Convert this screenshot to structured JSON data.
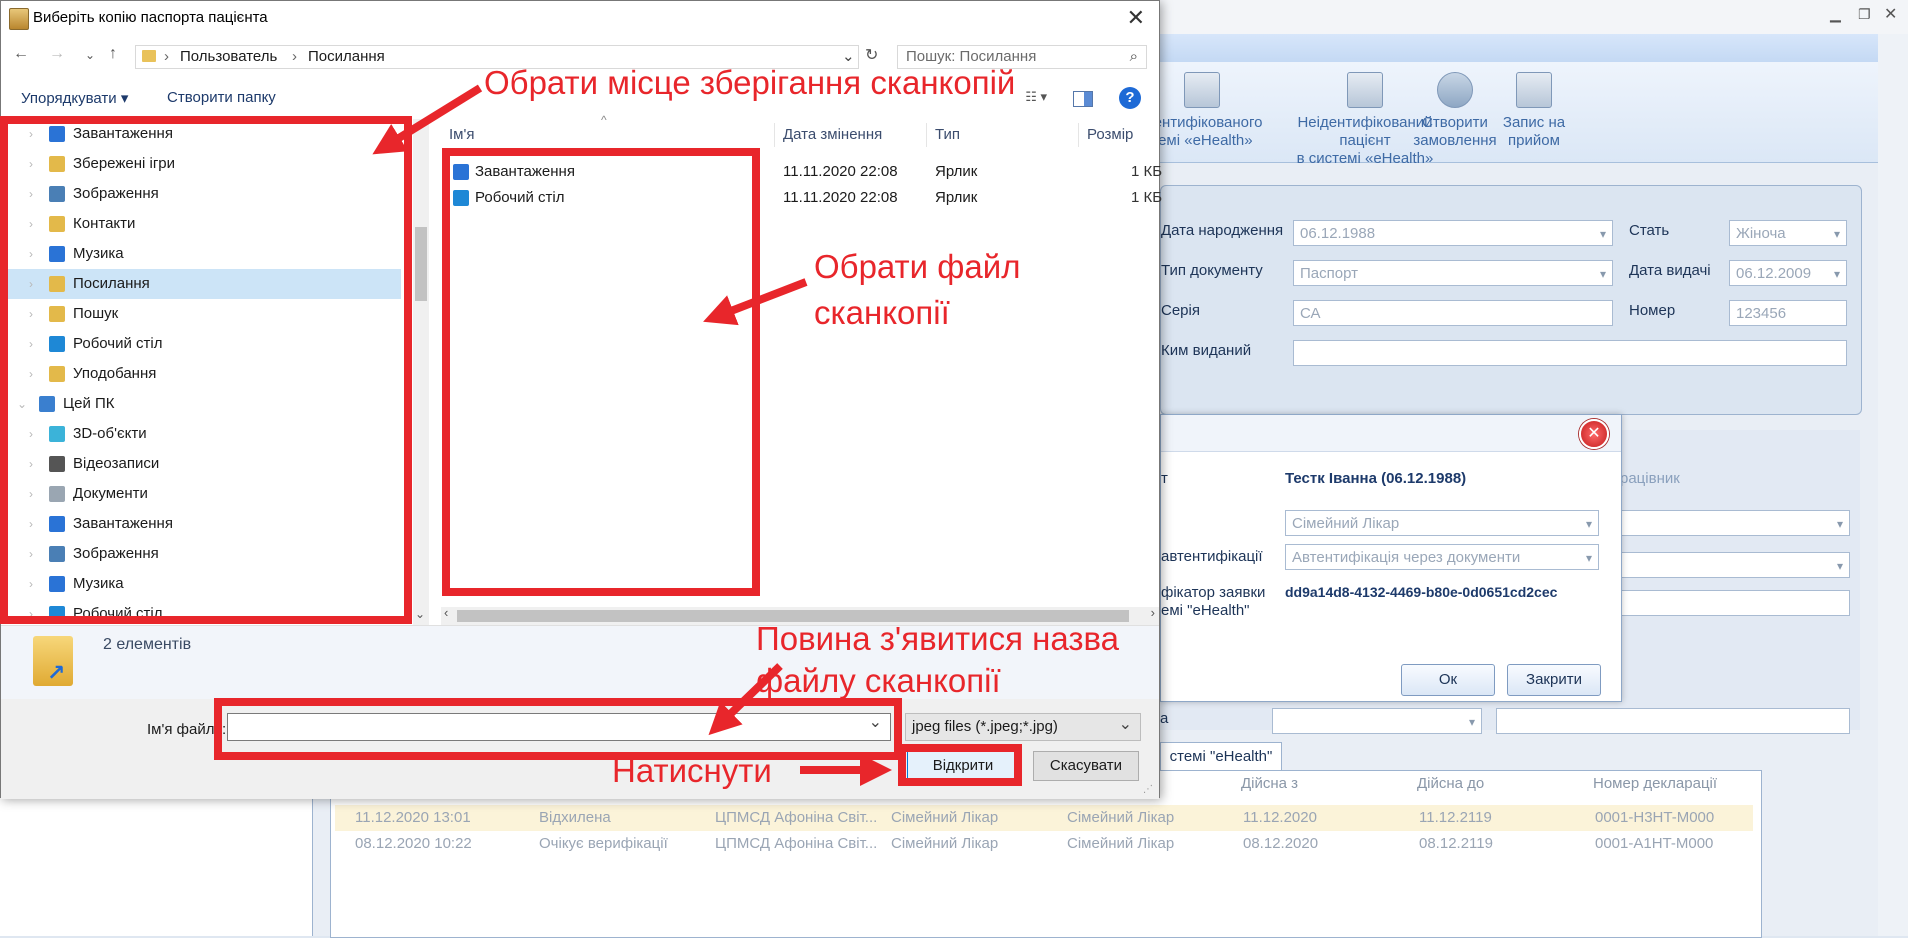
{
  "background_app": {
    "ribbon_buttons": [
      {
        "line1": "ідентифікованого",
        "line2": "темі «eHealth»"
      },
      {
        "line1": "Неідентифікований пацієнт",
        "line2": "в системі «eHealth»"
      },
      {
        "line1": "Створити",
        "line2": "замовлення"
      },
      {
        "line1": "Запис на",
        "line2": "прийом"
      }
    ],
    "form": {
      "birth_date_label": "Дата народження",
      "birth_date_value": "06.12.1988",
      "sex_label": "Стать",
      "sex_value": "Жіноча",
      "doc_type_label": "Тип документу",
      "doc_type_value": "Паспорт",
      "issue_date_label": "Дата видачі",
      "issue_date_value": "06.12.2009",
      "series_label": "Серія",
      "series_value": "СА",
      "number_label": "Номер",
      "number_value": "123456",
      "issued_by_label": "Ким виданий",
      "issued_by_value": ""
    },
    "right_partial_label": "рацівник",
    "modal": {
      "field1_label": "т",
      "patient": "Тестк Іванна  (06.12.1988)",
      "role_value": "Сімейний Лікар",
      "auth_label": "автентифікації",
      "auth_value": "Автентифікація через документи",
      "req_label_1": "фікатор заявки",
      "req_label_2": "емі \"eHealth\"",
      "req_id": "dd9a14d8-4132-4469-b80e-0d0651cd2cec",
      "ok_label": "Ок",
      "close_label": "Закрити"
    },
    "lower_label": "а",
    "tab_label": "стемі \"eHealth\"",
    "grid": {
      "headers": [
        "Дійсна з",
        "Дійсна до",
        "Номер декларації"
      ],
      "rows": [
        {
          "date": "11.12.2020 13:01",
          "status": "Відхилена",
          "org": "ЦПМСД Афоніна Світ...",
          "role1": "Сімейний Лікар",
          "role2": "Сімейний Лікар",
          "from": "11.12.2020",
          "to": "11.12.2119",
          "number": "0001-H3HT-M000"
        },
        {
          "date": "08.12.2020 10:22",
          "status": "Очікує верифікації",
          "org": "ЦПМСД Афоніна Світ...",
          "role1": "Сімейний Лікар",
          "role2": "Сімейний Лікар",
          "from": "08.12.2020",
          "to": "08.12.2119",
          "number": "0001-A1HT-M000"
        }
      ]
    }
  },
  "dialog": {
    "title": "Виберіть копію паспорта пацієнта",
    "breadcrumb": [
      "Пользователь",
      "Посилання"
    ],
    "search_placeholder": "Пошук: Посилання",
    "toolbar": {
      "organize": "Упорядкувати ▾",
      "new_folder": "Створити папку"
    },
    "tree": [
      {
        "label": "Завантаження",
        "indent": 1,
        "icon": "download-icon",
        "color": "#2a73d6"
      },
      {
        "label": "Збережені ігри",
        "indent": 1,
        "icon": "games-icon",
        "color": "#e3b94a"
      },
      {
        "label": "Зображення",
        "indent": 1,
        "icon": "pictures-icon",
        "color": "#4a7fb5"
      },
      {
        "label": "Контакти",
        "indent": 1,
        "icon": "contacts-icon",
        "color": "#e3b94a"
      },
      {
        "label": "Музика",
        "indent": 1,
        "icon": "music-icon",
        "color": "#2a73d6"
      },
      {
        "label": "Посилання",
        "indent": 1,
        "icon": "links-icon",
        "color": "#e3b94a",
        "selected": true
      },
      {
        "label": "Пошук",
        "indent": 1,
        "icon": "search-folder-icon",
        "color": "#e3b94a"
      },
      {
        "label": "Робочий стіл",
        "indent": 1,
        "icon": "desktop-icon",
        "color": "#1e88d6"
      },
      {
        "label": "Уподобання",
        "indent": 1,
        "icon": "favorites-icon",
        "color": "#e3b94a"
      },
      {
        "label": "Цей ПК",
        "indent": 0,
        "icon": "pc-icon",
        "color": "#3a7fcf"
      },
      {
        "label": "3D-об'єкти",
        "indent": 1,
        "icon": "3d-objects-icon",
        "color": "#3bb3d9"
      },
      {
        "label": "Відеозаписи",
        "indent": 1,
        "icon": "videos-icon",
        "color": "#555"
      },
      {
        "label": "Документи",
        "indent": 1,
        "icon": "documents-icon",
        "color": "#9aa6b2"
      },
      {
        "label": "Завантаження",
        "indent": 1,
        "icon": "download-icon",
        "color": "#2a73d6"
      },
      {
        "label": "Зображення",
        "indent": 1,
        "icon": "pictures-icon",
        "color": "#4a7fb5"
      },
      {
        "label": "Музика",
        "indent": 1,
        "icon": "music-icon",
        "color": "#2a73d6"
      },
      {
        "label": "Робочий стіл",
        "indent": 1,
        "icon": "desktop-icon",
        "color": "#1e88d6"
      }
    ],
    "columns": [
      "Ім'я",
      "Дата змінення",
      "Тип",
      "Розмір"
    ],
    "files": [
      {
        "name": "Завантаження",
        "date": "11.11.2020 22:08",
        "type": "Ярлик",
        "size": "1 КБ",
        "icon": "download-shortcut-icon",
        "color": "#2a73d6"
      },
      {
        "name": "Робочий стіл",
        "date": "11.11.2020 22:08",
        "type": "Ярлик",
        "size": "1 КБ",
        "icon": "desktop-shortcut-icon",
        "color": "#1e88d6"
      }
    ],
    "details_text": "2 елементів",
    "filename_label": "Ім'я файлу:",
    "filename_value": "",
    "filetype_value": "jpeg files (*.jpeg;*.jpg)",
    "open_label": "Відкрити",
    "cancel_label": "Скасувати"
  },
  "annotations": {
    "choose_location": "Обрати місце зберігання сканкопій",
    "choose_file_1": "Обрати файл",
    "choose_file_2": "сканкопії",
    "filename_appears_1": "Повина з'явитися назва",
    "filename_appears_2": "файлу сканкопії",
    "press": "Натиснути",
    "color": "#e8262b"
  }
}
